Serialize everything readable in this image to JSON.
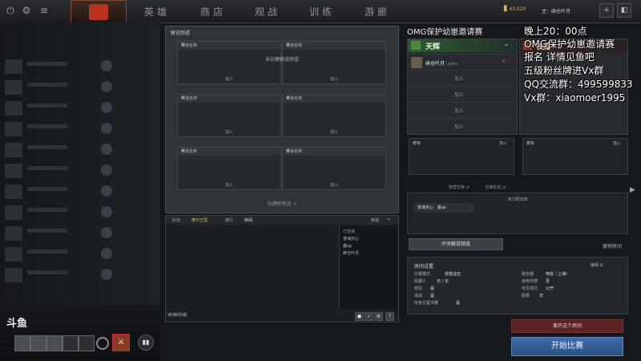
{
  "topbar": {
    "nav": [
      "英雄",
      "商店",
      "观战",
      "训练",
      "游廊"
    ],
    "gold": "43,520",
    "user_label": "主：",
    "user_name": "麻仓叶月"
  },
  "spectator": {
    "title": "解说频道",
    "channel_label": "频道名称",
    "no_channel": "未创建解说频道",
    "join": "加入",
    "create": "创建新频道"
  },
  "chat": {
    "tabs": [
      "队伍",
      "摩尔王国",
      "旅行",
      "房间"
    ],
    "channel_label": "频道",
    "list": [
      "已连接",
      "普海天心",
      "鑫sp",
      "麻仓叶月"
    ],
    "input": "对(房间)说:"
  },
  "lobby": {
    "title": "OMG保护幼崽邀请赛",
    "radiant": "天辉",
    "dire": "夜魇",
    "player": "麻仓叶月",
    "player_tag": "(主持人)",
    "join": "加入",
    "coach": "教练",
    "swap_sides": "阵营交换",
    "swap_teams": "交换队伍",
    "unassigned": "未分配玩家",
    "unassigned_players": [
      "普海天心",
      "鑫sp"
    ],
    "open_spec": "开关解说频道",
    "cancel_room": "撤销房间",
    "leave": "离开这个房间",
    "start": "开始比赛"
  },
  "settings": {
    "title": "房间设置",
    "edit": "编辑",
    "rows": [
      {
        "k": "比赛模式",
        "v": "技能征召"
      },
      {
        "k": "机器人",
        "v": "无 / 无"
      },
      {
        "k": "密码",
        "v": "是"
      },
      {
        "k": "观战",
        "v": "是"
      },
      {
        "k": "玩家位置决赛",
        "v": "是"
      }
    ],
    "rows2": [
      {
        "k": "服务器",
        "v": "电信（上海）"
      },
      {
        "k": "启用作弊",
        "v": "否"
      },
      {
        "k": "可见情况",
        "v": "公开"
      },
      {
        "k": "联赛",
        "v": "无"
      }
    ]
  },
  "overlay": [
    "晚上20：00点",
    "OMG保护幼崽邀请赛",
    "报名 详情见鱼吧",
    "五级粉丝牌进Vx群",
    "QQ交流群：499599833",
    "Vx群：xiaomoer1995"
  ],
  "brand": "斗鱼",
  "colors": {
    "start": "#2f5c97",
    "leave": "#5a2424",
    "radiant": "#2e5a2e"
  }
}
